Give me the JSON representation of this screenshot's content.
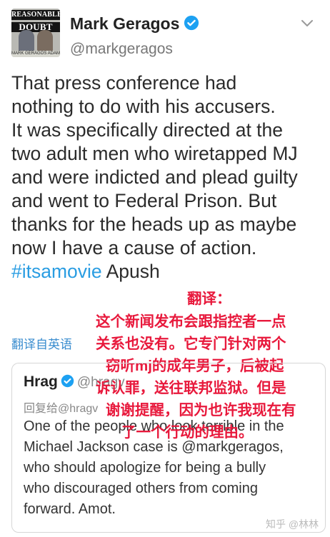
{
  "avatar": {
    "line1": "REASONABLE",
    "line2": "DOUBT",
    "names": "MARK GERAGOS   ADAM CAROLLA"
  },
  "author": {
    "name": "Mark Geragos",
    "handle": "@markgeragos",
    "verified": true
  },
  "tweet": {
    "text_lines": [
      "That press conference had",
      "nothing to do with his accusers.",
      "It was specifically directed at the",
      "two adult men who wiretapped MJ",
      "and were indicted and plead guilty",
      "and went to Federal Prison. But",
      "thanks for the heads up as maybe",
      "now I have a cause of action."
    ],
    "hashtag": "#itsamovie",
    "tail": " Apush"
  },
  "translate_link": "翻译自英语",
  "overlay": {
    "label": "翻译：",
    "lines": [
      "这个新闻发布会跟指控者一点",
      "关系也没有。它专门针对两个",
      "窃听mj的成年男子，后被起",
      "诉认罪，送往联邦监狱。但是",
      "谢谢提醒，因为也许我现在有",
      "了一个行动的理由。"
    ]
  },
  "quoted": {
    "name": "Hrag",
    "handle": "@hragv",
    "reply_prefix": "回复给",
    "reply_to": "@hragv",
    "body_lines": [
      "One of the people who look terrible in the",
      "Michael Jackson case is @markgeragos,",
      "who should apologize for being a bully",
      "who discouraged others from coming",
      "forward. Amot."
    ]
  },
  "watermark": "知乎 @林林",
  "colors": {
    "accent": "#1da1f2",
    "overlay_text": "#e8193c",
    "translate_link": "#3a8dcf"
  }
}
